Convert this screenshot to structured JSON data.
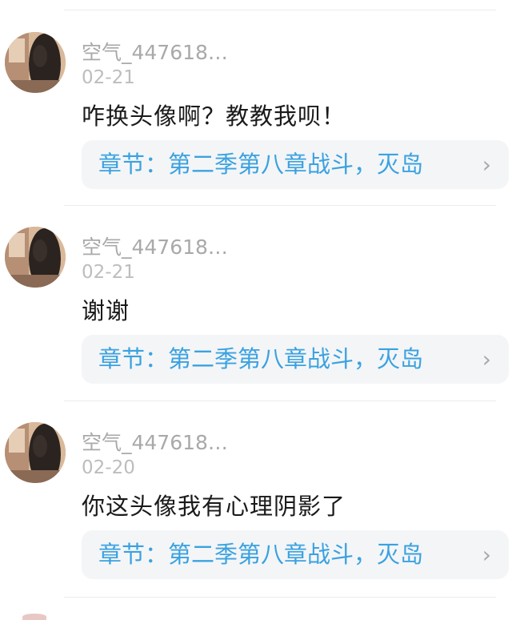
{
  "comments": [
    {
      "username": "空气_447618…",
      "date": "02-21",
      "content": "咋换头像啊？教教我呗！",
      "chapter": "章节：第二季第八章战斗，灭岛",
      "chevron_icon": "chevron-right-icon"
    },
    {
      "username": "空气_447618…",
      "date": "02-21",
      "content": "谢谢",
      "chapter": "章节：第二季第八章战斗，灭岛",
      "chevron_icon": "chevron-right-icon"
    },
    {
      "username": "空气_447618…",
      "date": "02-20",
      "content": "你这头像我有心理阴影了",
      "chapter": "章节：第二季第八章战斗，灭岛",
      "chevron_icon": "chevron-right-icon"
    }
  ],
  "colors": {
    "link": "#3aa2e0",
    "username": "#a9a9a9",
    "date": "#bdbdbd",
    "content": "#1a1a1a",
    "card_bg": "#f4f5f7"
  }
}
